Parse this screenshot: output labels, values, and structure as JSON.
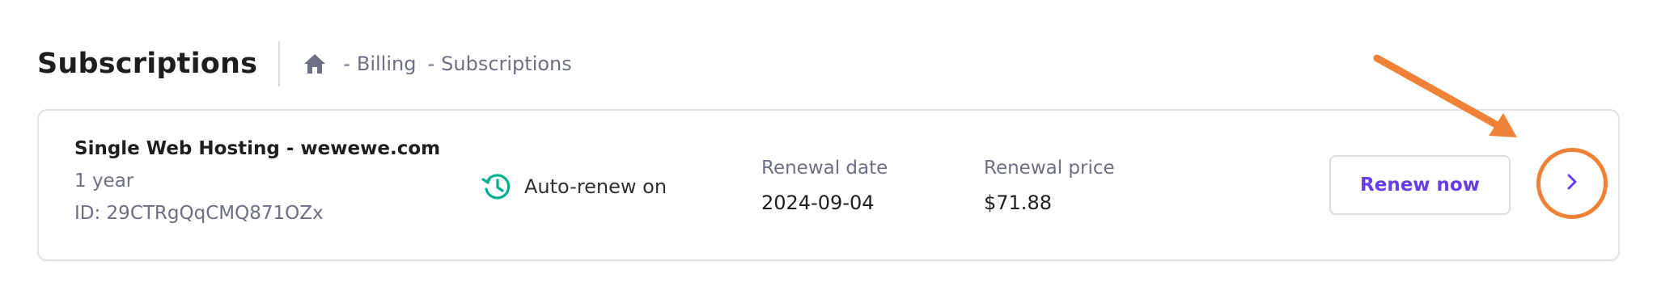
{
  "header": {
    "title": "Subscriptions",
    "breadcrumb": {
      "home_icon": "home-icon",
      "items": [
        "Billing",
        "Subscriptions"
      ],
      "separator": "-"
    }
  },
  "subscription": {
    "product_name": "Single Web Hosting - wewewe.com",
    "term": "1 year",
    "id_text": "ID: 29CTRgQqCMQ871OZx",
    "auto_renew": {
      "icon": "history-icon",
      "label": "Auto-renew on",
      "color": "#00b090"
    },
    "renewal_date": {
      "label": "Renewal date",
      "value": "2024-09-04"
    },
    "renewal_price": {
      "label": "Renewal price",
      "value": "$71.88"
    },
    "renew_button_label": "Renew now",
    "details_button_icon": "chevron-right-icon"
  },
  "colors": {
    "accent": "#673de6",
    "annotation": "#f08237",
    "muted_text": "#6d7081",
    "border": "#e3e4e8"
  }
}
